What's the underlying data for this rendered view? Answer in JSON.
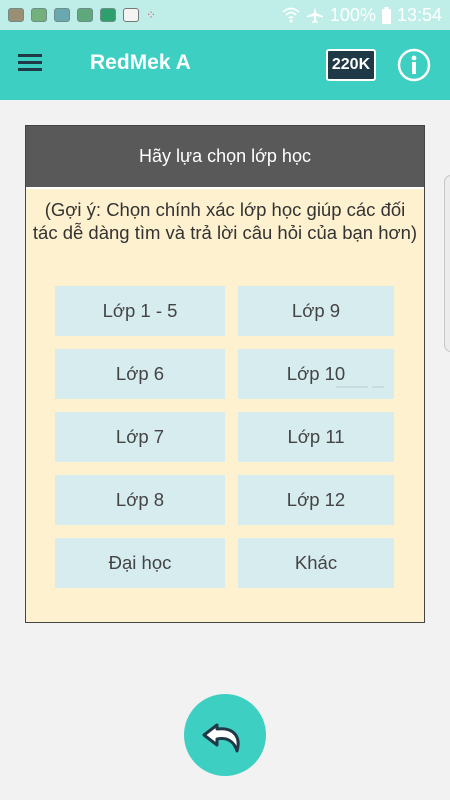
{
  "status_bar": {
    "battery": "100%",
    "time": "13:54",
    "icons": [
      "app-notification-icon",
      "app-notification-icon",
      "app-notification-icon",
      "app-notification-icon",
      "app-notification-icon",
      "gallery-icon",
      "dots-icon",
      "wifi-icon",
      "airplane-mode-icon",
      "battery-icon"
    ]
  },
  "app_bar": {
    "title": "RedMek A",
    "coins": "220K",
    "accent_color": "#3ecfc3",
    "menu_icon": "hamburger-menu-icon",
    "info_icon": "info-icon"
  },
  "card": {
    "title": "Hãy lựa chọn lớp học",
    "hint": "(Gợi ý: Chọn chính xác lớp học giúp các đối tác dễ dàng tìm và trả lời câu hỏi của bạn hơn)",
    "grades": [
      "Lớp 1 - 5",
      "Lớp 9",
      "Lớp 6",
      "Lớp 10",
      "Lớp 7",
      "Lớp 11",
      "Lớp 8",
      "Lớp 12",
      "Đại học",
      "Khác"
    ]
  },
  "fab": {
    "icon": "undo-back-icon"
  }
}
